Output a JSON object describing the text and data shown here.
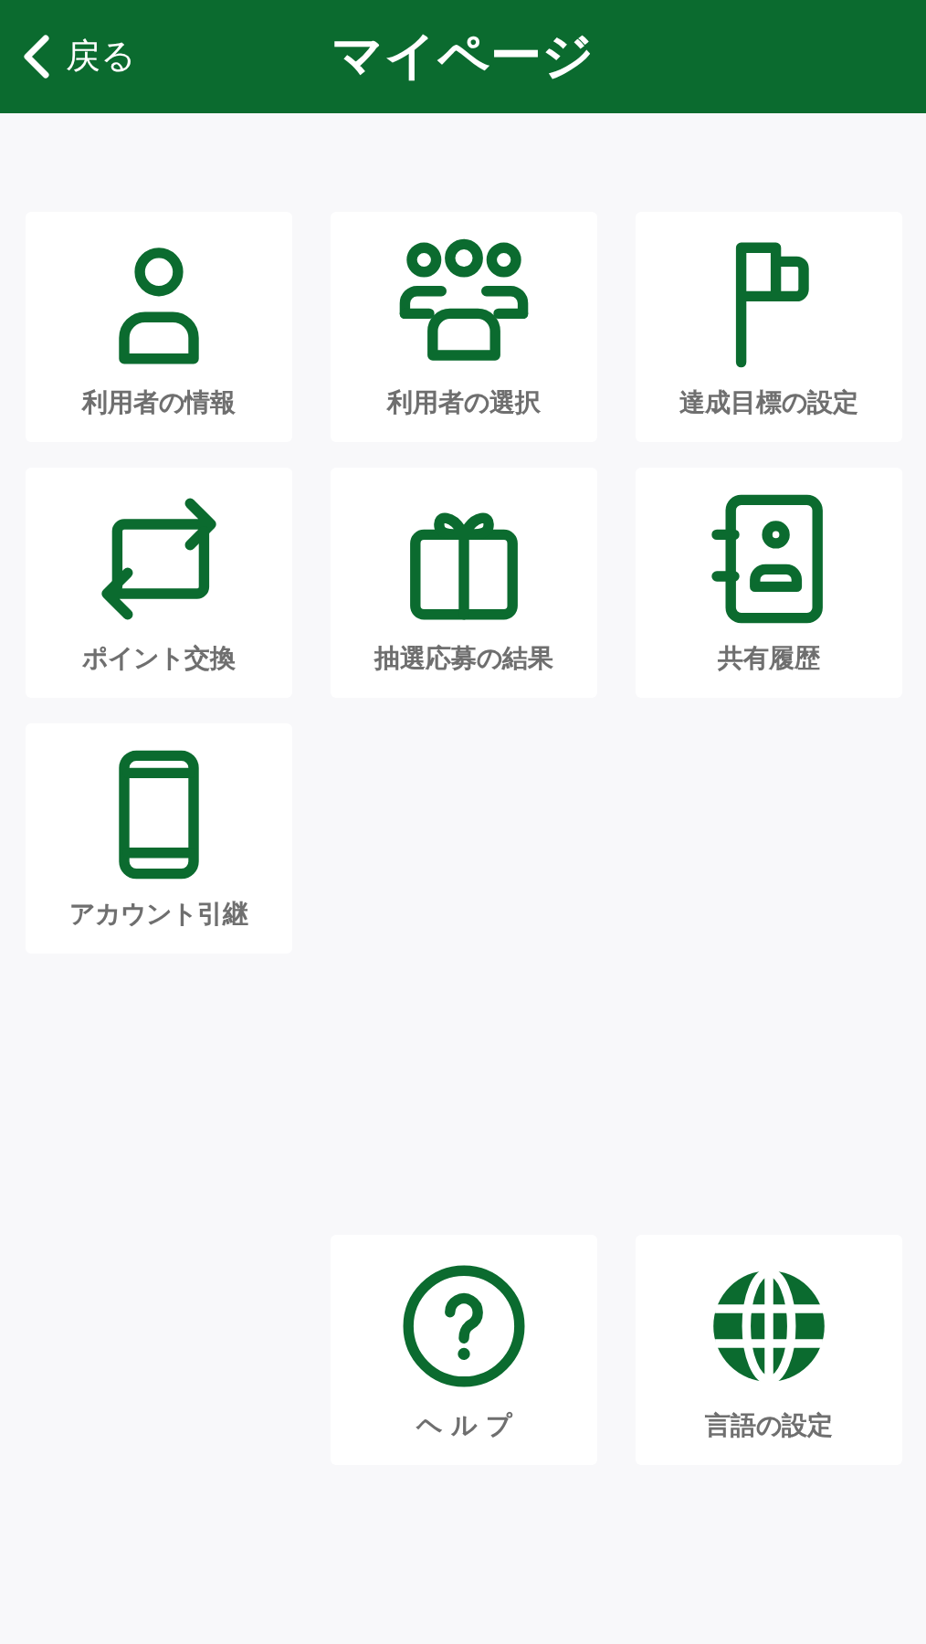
{
  "header": {
    "back_label": "戻る",
    "title": "マイページ"
  },
  "menu_items": [
    {
      "label": "利用者の情報",
      "kind": "person"
    },
    {
      "label": "利用者の選択",
      "kind": "group"
    },
    {
      "label": "達成目標の設定",
      "kind": "flag"
    },
    {
      "label": "ポイント交換",
      "kind": "exchange"
    },
    {
      "label": "抽選応募の結果",
      "kind": "gift"
    },
    {
      "label": "共有履歴",
      "kind": "contacts"
    },
    {
      "label": "アカウント引継",
      "kind": "phone"
    }
  ],
  "bottom_items": [
    {
      "label": "ヘ ル プ",
      "kind": "help"
    },
    {
      "label": "言語の設定",
      "kind": "globe"
    }
  ]
}
